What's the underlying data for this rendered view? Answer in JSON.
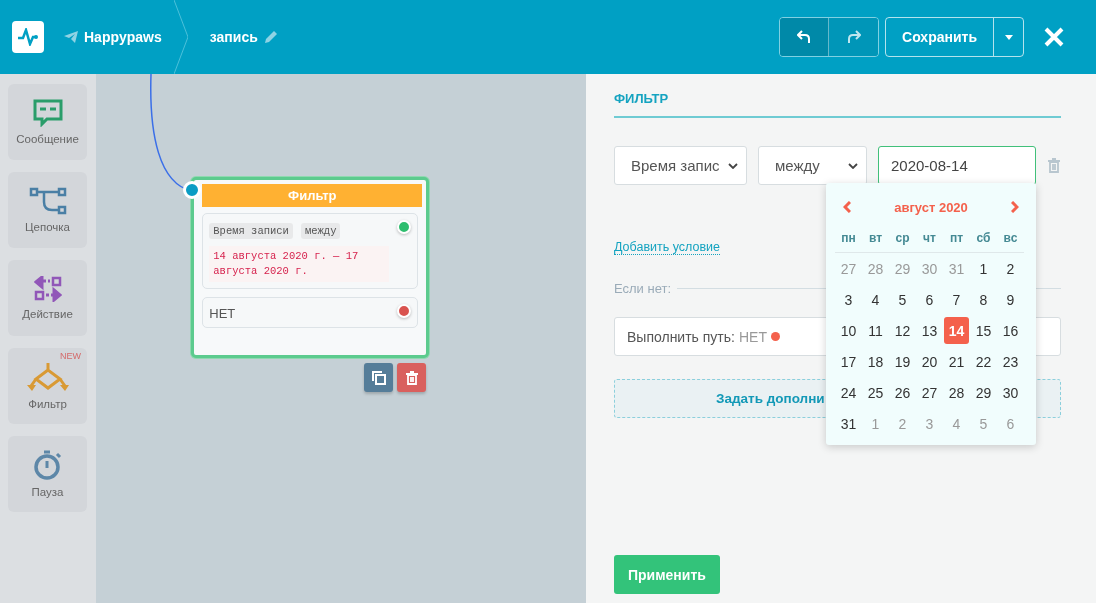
{
  "header": {
    "bot": "Happypaws",
    "scenario": "запись",
    "save": "Сохранить"
  },
  "tools": [
    {
      "kind": "message",
      "label": "Сообщение"
    },
    {
      "kind": "chain",
      "label": "Цепочка"
    },
    {
      "kind": "action",
      "label": "Действие"
    },
    {
      "kind": "filter",
      "label": "Фильтр",
      "badge": "NEW"
    },
    {
      "kind": "pause",
      "label": "Пауза"
    }
  ],
  "node": {
    "title": "Фильтр",
    "tags": [
      "Время записи",
      "между"
    ],
    "value": "14 августа 2020 г. — 17 августа 2020 г.",
    "outputs": [
      {
        "kind": "condition",
        "color": "#2ebd6e"
      },
      {
        "kind": "else",
        "label": "НЕТ",
        "color": "#d9534f"
      }
    ]
  },
  "panel": {
    "title": "ФИЛЬТР",
    "field_select": "Время запис",
    "operator_select": "между",
    "date_value": "2020-08-14",
    "add_condition": "Добавить условие",
    "else_label": "Если нет:",
    "else_path_label": "Выполнить путь:",
    "else_path_value": "НЕТ",
    "extra_button": "Задать дополни",
    "apply": "Применить"
  },
  "calendar": {
    "month": "август 2020",
    "weekdays": [
      "пн",
      "вт",
      "ср",
      "чт",
      "пт",
      "сб",
      "вс"
    ],
    "days": [
      {
        "label": "27",
        "other_month": true,
        "selected": false
      },
      {
        "label": "28",
        "other_month": true,
        "selected": false
      },
      {
        "label": "29",
        "other_month": true,
        "selected": false
      },
      {
        "label": "30",
        "other_month": true,
        "selected": false
      },
      {
        "label": "31",
        "other_month": true,
        "selected": false
      },
      {
        "label": "1",
        "other_month": false,
        "selected": false
      },
      {
        "label": "2",
        "other_month": false,
        "selected": false
      },
      {
        "label": "3",
        "other_month": false,
        "selected": false
      },
      {
        "label": "4",
        "other_month": false,
        "selected": false
      },
      {
        "label": "5",
        "other_month": false,
        "selected": false
      },
      {
        "label": "6",
        "other_month": false,
        "selected": false
      },
      {
        "label": "7",
        "other_month": false,
        "selected": false
      },
      {
        "label": "8",
        "other_month": false,
        "selected": false
      },
      {
        "label": "9",
        "other_month": false,
        "selected": false
      },
      {
        "label": "10",
        "other_month": false,
        "selected": false
      },
      {
        "label": "11",
        "other_month": false,
        "selected": false
      },
      {
        "label": "12",
        "other_month": false,
        "selected": false
      },
      {
        "label": "13",
        "other_month": false,
        "selected": false
      },
      {
        "label": "14",
        "other_month": false,
        "selected": true
      },
      {
        "label": "15",
        "other_month": false,
        "selected": false
      },
      {
        "label": "16",
        "other_month": false,
        "selected": false
      },
      {
        "label": "17",
        "other_month": false,
        "selected": false
      },
      {
        "label": "18",
        "other_month": false,
        "selected": false
      },
      {
        "label": "19",
        "other_month": false,
        "selected": false
      },
      {
        "label": "20",
        "other_month": false,
        "selected": false
      },
      {
        "label": "21",
        "other_month": false,
        "selected": false
      },
      {
        "label": "22",
        "other_month": false,
        "selected": false
      },
      {
        "label": "23",
        "other_month": false,
        "selected": false
      },
      {
        "label": "24",
        "other_month": false,
        "selected": false
      },
      {
        "label": "25",
        "other_month": false,
        "selected": false
      },
      {
        "label": "26",
        "other_month": false,
        "selected": false
      },
      {
        "label": "27",
        "other_month": false,
        "selected": false
      },
      {
        "label": "28",
        "other_month": false,
        "selected": false
      },
      {
        "label": "29",
        "other_month": false,
        "selected": false
      },
      {
        "label": "30",
        "other_month": false,
        "selected": false
      },
      {
        "label": "31",
        "other_month": false,
        "selected": false
      },
      {
        "label": "1",
        "other_month": true,
        "selected": false
      },
      {
        "label": "2",
        "other_month": true,
        "selected": false
      },
      {
        "label": "3",
        "other_month": true,
        "selected": false
      },
      {
        "label": "4",
        "other_month": true,
        "selected": false
      },
      {
        "label": "5",
        "other_month": true,
        "selected": false
      },
      {
        "label": "6",
        "other_month": true,
        "selected": false
      }
    ]
  }
}
